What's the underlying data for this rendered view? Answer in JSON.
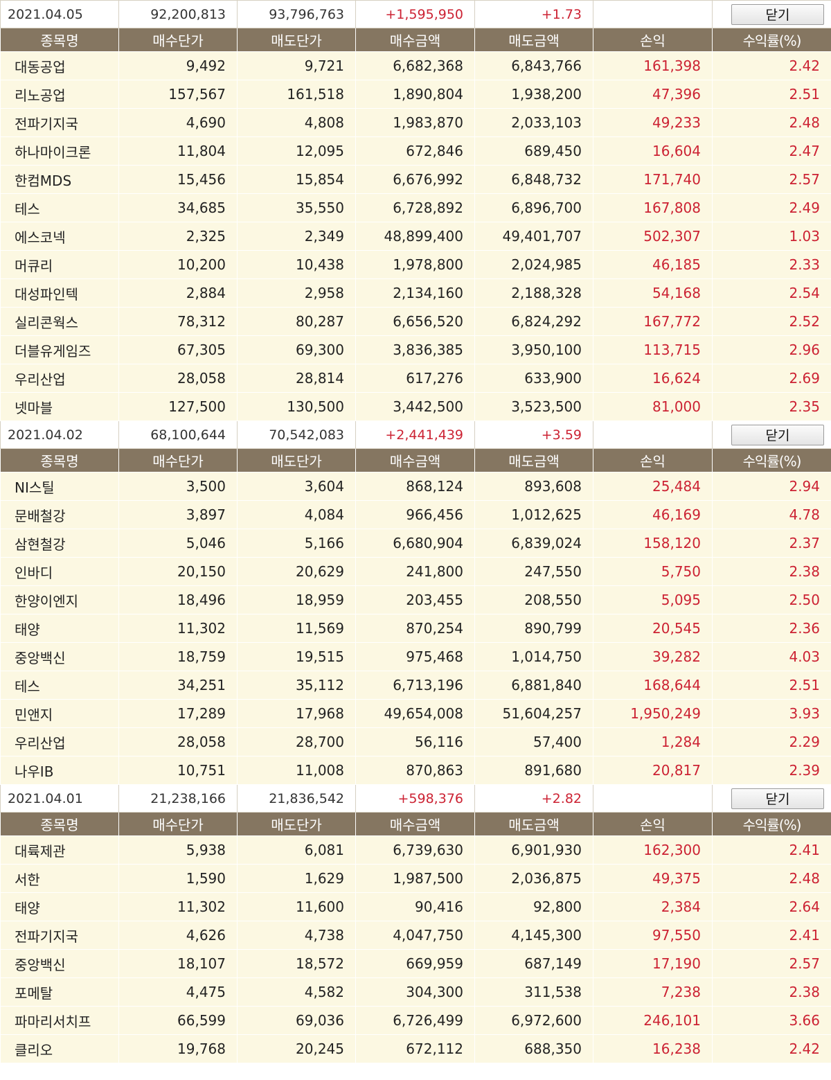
{
  "close_label": "닫기",
  "columns": [
    "종목명",
    "매수단가",
    "매도단가",
    "매수금액",
    "매도금액",
    "손익",
    "수익률(%)"
  ],
  "days": [
    {
      "date": "2021.04.05",
      "buy_total": "92,200,813",
      "sell_total": "93,796,763",
      "profit": "+1,595,950",
      "rate": "+1.73",
      "rows": [
        [
          "대동공업",
          "9,492",
          "9,721",
          "6,682,368",
          "6,843,766",
          "161,398",
          "2.42"
        ],
        [
          "리노공업",
          "157,567",
          "161,518",
          "1,890,804",
          "1,938,200",
          "47,396",
          "2.51"
        ],
        [
          "전파기지국",
          "4,690",
          "4,808",
          "1,983,870",
          "2,033,103",
          "49,233",
          "2.48"
        ],
        [
          "하나마이크론",
          "11,804",
          "12,095",
          "672,846",
          "689,450",
          "16,604",
          "2.47"
        ],
        [
          "한컴MDS",
          "15,456",
          "15,854",
          "6,676,992",
          "6,848,732",
          "171,740",
          "2.57"
        ],
        [
          "테스",
          "34,685",
          "35,550",
          "6,728,892",
          "6,896,700",
          "167,808",
          "2.49"
        ],
        [
          "에스코넥",
          "2,325",
          "2,349",
          "48,899,400",
          "49,401,707",
          "502,307",
          "1.03"
        ],
        [
          "머큐리",
          "10,200",
          "10,438",
          "1,978,800",
          "2,024,985",
          "46,185",
          "2.33"
        ],
        [
          "대성파인텍",
          "2,884",
          "2,958",
          "2,134,160",
          "2,188,328",
          "54,168",
          "2.54"
        ],
        [
          "실리콘웍스",
          "78,312",
          "80,287",
          "6,656,520",
          "6,824,292",
          "167,772",
          "2.52"
        ],
        [
          "더블유게임즈",
          "67,305",
          "69,300",
          "3,836,385",
          "3,950,100",
          "113,715",
          "2.96"
        ],
        [
          "우리산업",
          "28,058",
          "28,814",
          "617,276",
          "633,900",
          "16,624",
          "2.69"
        ],
        [
          "넷마블",
          "127,500",
          "130,500",
          "3,442,500",
          "3,523,500",
          "81,000",
          "2.35"
        ]
      ]
    },
    {
      "date": "2021.04.02",
      "buy_total": "68,100,644",
      "sell_total": "70,542,083",
      "profit": "+2,441,439",
      "rate": "+3.59",
      "rows": [
        [
          "NI스틸",
          "3,500",
          "3,604",
          "868,124",
          "893,608",
          "25,484",
          "2.94"
        ],
        [
          "문배철강",
          "3,897",
          "4,084",
          "966,456",
          "1,012,625",
          "46,169",
          "4.78"
        ],
        [
          "삼현철강",
          "5,046",
          "5,166",
          "6,680,904",
          "6,839,024",
          "158,120",
          "2.37"
        ],
        [
          "인바디",
          "20,150",
          "20,629",
          "241,800",
          "247,550",
          "5,750",
          "2.38"
        ],
        [
          "한양이엔지",
          "18,496",
          "18,959",
          "203,455",
          "208,550",
          "5,095",
          "2.50"
        ],
        [
          "태양",
          "11,302",
          "11,569",
          "870,254",
          "890,799",
          "20,545",
          "2.36"
        ],
        [
          "중앙백신",
          "18,759",
          "19,515",
          "975,468",
          "1,014,750",
          "39,282",
          "4.03"
        ],
        [
          "테스",
          "34,251",
          "35,112",
          "6,713,196",
          "6,881,840",
          "168,644",
          "2.51"
        ],
        [
          "민앤지",
          "17,289",
          "17,968",
          "49,654,008",
          "51,604,257",
          "1,950,249",
          "3.93"
        ],
        [
          "우리산업",
          "28,058",
          "28,700",
          "56,116",
          "57,400",
          "1,284",
          "2.29"
        ],
        [
          "나우IB",
          "10,751",
          "11,008",
          "870,863",
          "891,680",
          "20,817",
          "2.39"
        ]
      ]
    },
    {
      "date": "2021.04.01",
      "buy_total": "21,238,166",
      "sell_total": "21,836,542",
      "profit": "+598,376",
      "rate": "+2.82",
      "rows": [
        [
          "대륙제관",
          "5,938",
          "6,081",
          "6,739,630",
          "6,901,930",
          "162,300",
          "2.41"
        ],
        [
          "서한",
          "1,590",
          "1,629",
          "1,987,500",
          "2,036,875",
          "49,375",
          "2.48"
        ],
        [
          "태양",
          "11,302",
          "11,600",
          "90,416",
          "92,800",
          "2,384",
          "2.64"
        ],
        [
          "전파기지국",
          "4,626",
          "4,738",
          "4,047,750",
          "4,145,300",
          "97,550",
          "2.41"
        ],
        [
          "중앙백신",
          "18,107",
          "18,572",
          "669,959",
          "687,149",
          "17,190",
          "2.57"
        ],
        [
          "포메탈",
          "4,475",
          "4,582",
          "304,300",
          "311,538",
          "7,238",
          "2.38"
        ],
        [
          "파마리서치프",
          "66,599",
          "69,036",
          "6,726,499",
          "6,972,600",
          "246,101",
          "3.66"
        ],
        [
          "클리오",
          "19,768",
          "20,245",
          "672,112",
          "688,350",
          "16,238",
          "2.42"
        ]
      ]
    }
  ]
}
